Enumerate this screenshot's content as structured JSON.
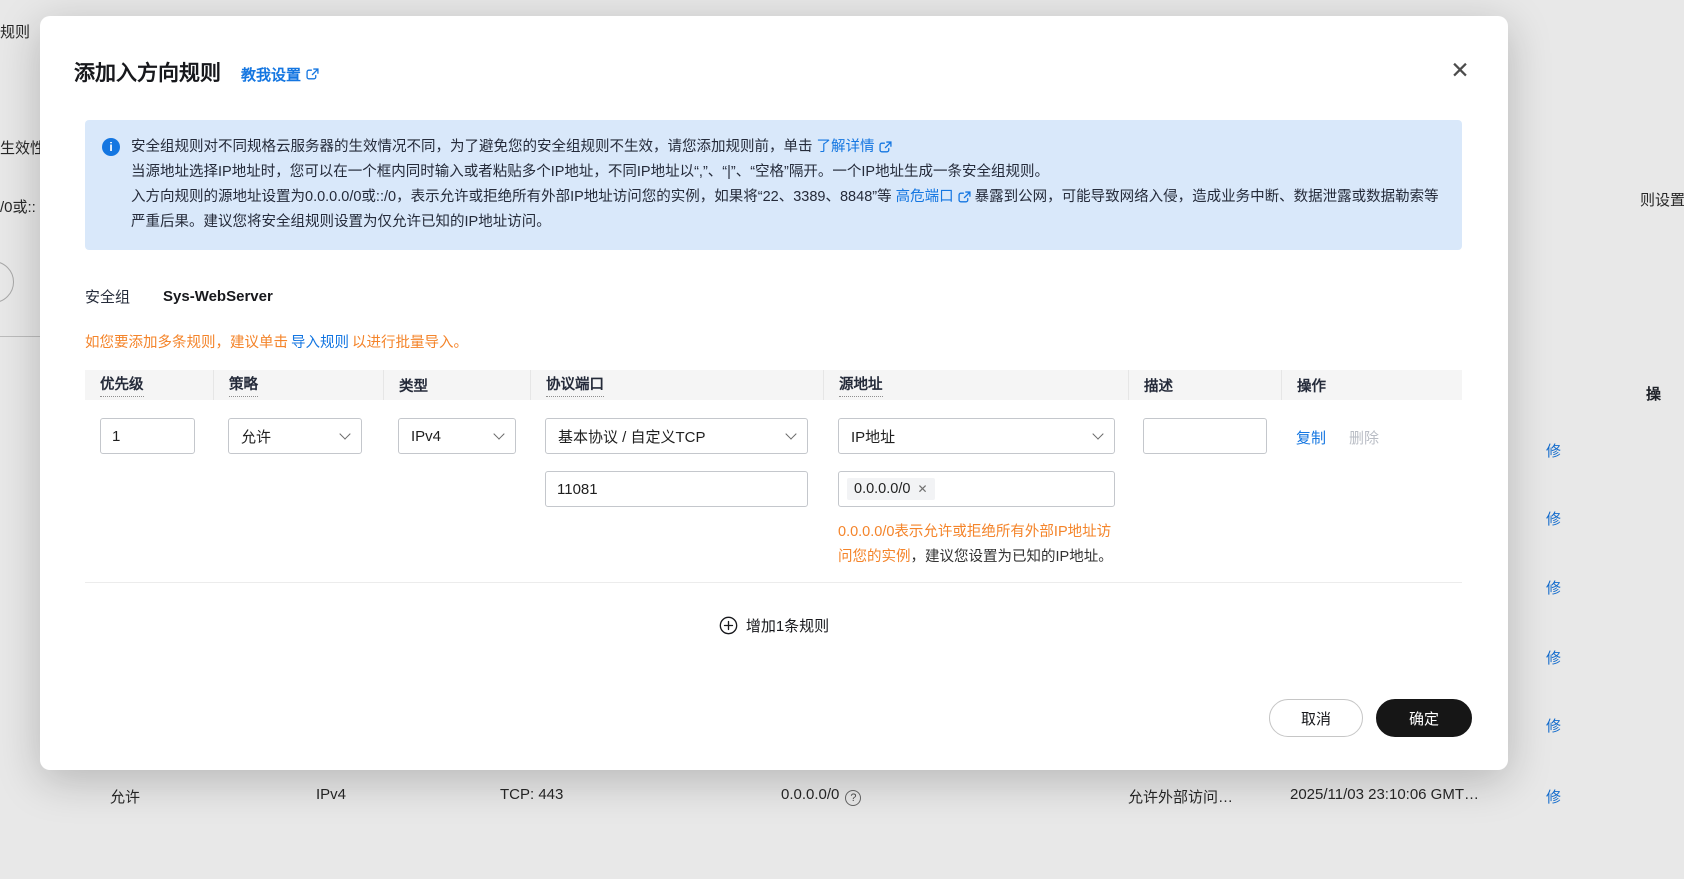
{
  "background": {
    "top_left": "规则",
    "left_fragment_1": "生效性",
    "left_fragment_2": "/0或::",
    "right_fragment_top": "则设置为",
    "right_col_header": "操",
    "right_action_links": [
      {
        "label": "修"
      },
      {
        "label": "修"
      },
      {
        "label": "修"
      },
      {
        "label": "修"
      },
      {
        "label": "修"
      }
    ],
    "bottom_row": {
      "policy": "允许",
      "type": "IPv4",
      "protocol": "TCP: 443",
      "source": "0.0.0.0/0",
      "description": "允许外部访问…",
      "updated": "2025/11/03 23:10:06 GMT…",
      "action": "修"
    }
  },
  "dialog": {
    "title": "添加入方向规则",
    "help_link": "教我设置",
    "alert": {
      "line1_text": "安全组规则对不同规格云服务器的生效情况不同，为了避免您的安全组规则不生效，请您添加规则前，单击",
      "line1_link": "了解详情",
      "line2_text": "当源地址选择IP地址时，您可以在一个框内同时输入或者粘贴多个IP地址，不同IP地址以“,”、“|”、“空格”隔开。一个IP地址生成一条安全组规则。",
      "line3_text": "入方向规则的源地址设置为0.0.0.0/0或::/0，表示允许或拒绝所有外部IP地址访问您的实例，如果将“22、3389、8848”等",
      "line3_link": "高危端口",
      "line3_suffix": "暴露到公网，可能导致网络入侵，造成业务中断、数据泄露或数据勒索等严重后果。建议您将安全组规则设置为仅允许已知的IP地址访问。"
    },
    "security_group_label": "安全组",
    "security_group_value": "Sys-WebServer",
    "import_tip": {
      "prefix": "如您要添加多条规则，建议单击",
      "link": "导入规则",
      "suffix": "以进行批量导入。"
    },
    "table": {
      "headers": {
        "priority": "优先级",
        "policy": "策略",
        "type": "类型",
        "protocol": "协议端口",
        "source": "源地址",
        "description": "描述",
        "operation": "操作"
      },
      "row": {
        "priority": "1",
        "policy": "允许",
        "type": "IPv4",
        "protocol": "基本协议 / 自定义TCP",
        "port": "11081",
        "source_type": "IP地址",
        "source_value": "0.0.0.0/0",
        "warning_highlight": "0.0.0.0/0表示允许或拒绝所有外部IP地址访问您的实例",
        "warning_rest": "，建议您设置为已知的IP地址。",
        "copy_label": "复制",
        "delete_label": "删除"
      }
    },
    "add_rule_label": "增加1条规则",
    "cancel_label": "取消",
    "confirm_label": "确定"
  }
}
